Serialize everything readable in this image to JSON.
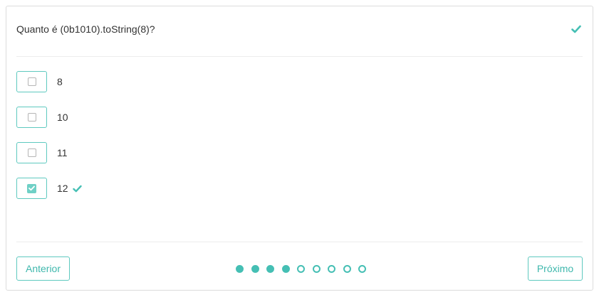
{
  "quiz": {
    "question": "Quanto é (0b1010).toString(8)?",
    "question_status": "correct",
    "options": [
      {
        "label": "8",
        "checked": false,
        "correct": false
      },
      {
        "label": "10",
        "checked": false,
        "correct": false
      },
      {
        "label": "11",
        "checked": false,
        "correct": false
      },
      {
        "label": "12",
        "checked": true,
        "correct": true
      }
    ]
  },
  "navigation": {
    "prev_label": "Anterior",
    "next_label": "Próximo",
    "total_questions": 9,
    "answered_count": 4
  },
  "colors": {
    "accent": "#45bfb4",
    "border": "#5ec9bf",
    "checked_fill": "#6fd0c6",
    "text": "#333333"
  },
  "icons": {
    "status": "check-icon",
    "checkbox": "checkbox-icon"
  }
}
